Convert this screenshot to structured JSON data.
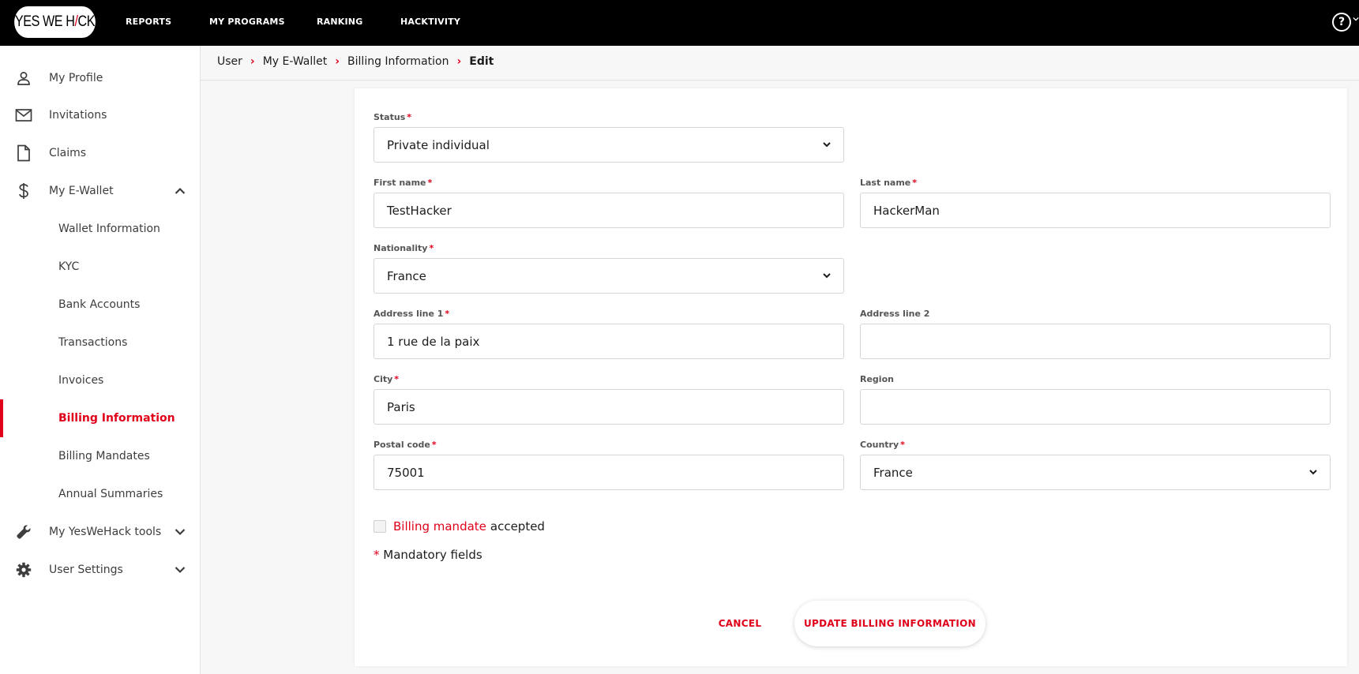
{
  "brand": {
    "logo_text_a": "YES WE H",
    "logo_text_slash": "/",
    "logo_text_b": "CK"
  },
  "topnav": {
    "items": [
      {
        "label": "REPORTS"
      },
      {
        "label": "MY PROGRAMS"
      },
      {
        "label": "RANKING"
      },
      {
        "label": "HACKTIVITY"
      }
    ],
    "help_label": "?"
  },
  "sidebar": {
    "items": [
      {
        "label": "My Profile",
        "icon": "user-icon"
      },
      {
        "label": "Invitations",
        "icon": "mail-icon"
      },
      {
        "label": "Claims",
        "icon": "document-icon"
      },
      {
        "label": "My E-Wallet",
        "icon": "dollar-icon",
        "expanded": true
      }
    ],
    "wallet_sub": [
      {
        "label": "Wallet Information"
      },
      {
        "label": "KYC"
      },
      {
        "label": "Bank Accounts"
      },
      {
        "label": "Transactions"
      },
      {
        "label": "Invoices"
      },
      {
        "label": "Billing Information",
        "active": true
      },
      {
        "label": "Billing Mandates"
      },
      {
        "label": "Annual Summaries"
      }
    ],
    "bottom_items": [
      {
        "label": "My YesWeHack tools",
        "icon": "wrench-icon"
      },
      {
        "label": "User Settings",
        "icon": "gear-icon"
      }
    ]
  },
  "breadcrumb": [
    "User",
    "My E-Wallet",
    "Billing Information",
    "Edit"
  ],
  "form": {
    "status": {
      "label": "Status",
      "required": "*",
      "value": "Private individual"
    },
    "first_name": {
      "label": "First name",
      "required": "*",
      "value": "TestHacker"
    },
    "last_name": {
      "label": "Last name",
      "required": "*",
      "value": "HackerMan"
    },
    "nationality": {
      "label": "Nationality",
      "required": "*",
      "value": "France"
    },
    "address1": {
      "label": "Address line 1",
      "required": "*",
      "value": "1 rue de la paix"
    },
    "address2": {
      "label": "Address line 2",
      "value": ""
    },
    "city": {
      "label": "City",
      "required": "*",
      "value": "Paris"
    },
    "region": {
      "label": "Region",
      "value": ""
    },
    "postal": {
      "label": "Postal code",
      "required": "*",
      "value": "75001"
    },
    "country": {
      "label": "Country",
      "required": "*",
      "value": "France"
    },
    "mandate_link": "Billing mandate",
    "mandate_text": "accepted",
    "mandatory_star": "*",
    "mandatory_text": "Mandatory fields",
    "cancel_label": "CANCEL",
    "submit_label": "UPDATE BILLING INFORMATION"
  },
  "colors": {
    "accent": "#e0001a",
    "topbar": "#000000"
  }
}
